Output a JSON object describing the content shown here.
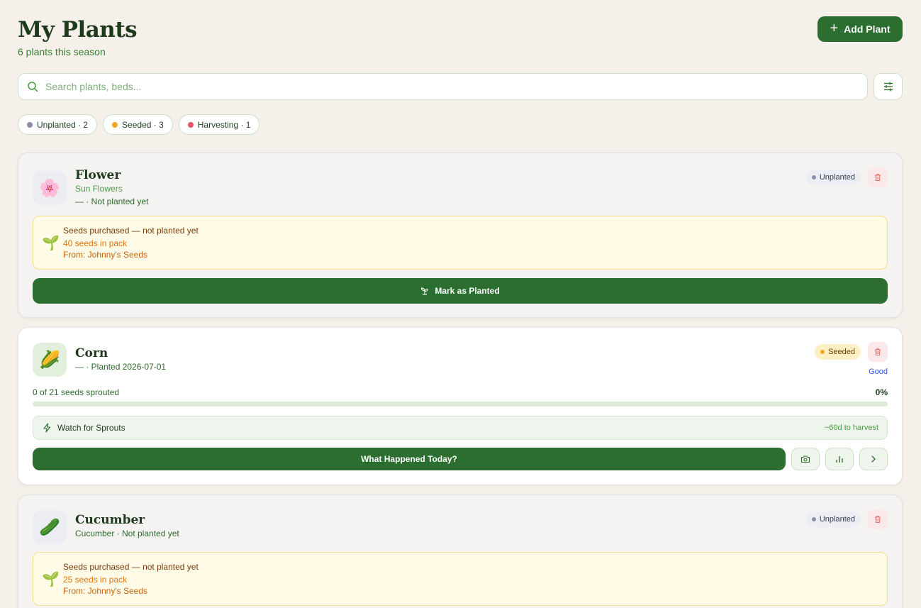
{
  "header": {
    "title": "My Plants",
    "subtitle": "6 plants this season",
    "add_button": "Add Plant"
  },
  "search": {
    "placeholder": "Search plants, beds..."
  },
  "filters": [
    {
      "label": "Unplanted · 2",
      "color": "#8a8fa6"
    },
    {
      "label": "Seeded · 3",
      "color": "#f0a526"
    },
    {
      "label": "Harvesting · 1",
      "color": "#e8536a"
    }
  ],
  "cards": [
    {
      "name": "Flower",
      "variety": "Sun Flowers",
      "meta": "— · Not planted yet",
      "status": "Unplanted",
      "icon": "blossom-icon",
      "emoji": "🌸",
      "seed_title": "Seeds purchased — not planted yet",
      "seed_count": "40 seeds in pack",
      "seed_source": "From: Johnny's Seeds",
      "action": "Mark as Planted"
    },
    {
      "name": "Corn",
      "meta": "— · Planted 2026-07-01",
      "status": "Seeded",
      "health": "Good",
      "icon": "corn-icon",
      "emoji": "🌽",
      "progress_label": "0 of 21 seeds sprouted",
      "progress_pct": "0%",
      "progress_fraction": 0,
      "watch": "Watch for Sprouts",
      "harvest": "~60d to harvest",
      "action": "What Happened Today?"
    },
    {
      "name": "Cucumber",
      "meta": "Cucumber · Not planted yet",
      "status": "Unplanted",
      "icon": "cucumber-icon",
      "emoji": "🥒",
      "seed_title": "Seeds purchased — not planted yet",
      "seed_count": "25 seeds in pack",
      "seed_source": "From: Johnny's Seeds"
    }
  ],
  "colors": {
    "primary": "#2b6e2f",
    "background": "#f5f0ea",
    "unplanted_dot": "#8a8fa6",
    "seeded_dot": "#f0a526",
    "delete": "#e57373",
    "health_good": "#2f55c9"
  }
}
